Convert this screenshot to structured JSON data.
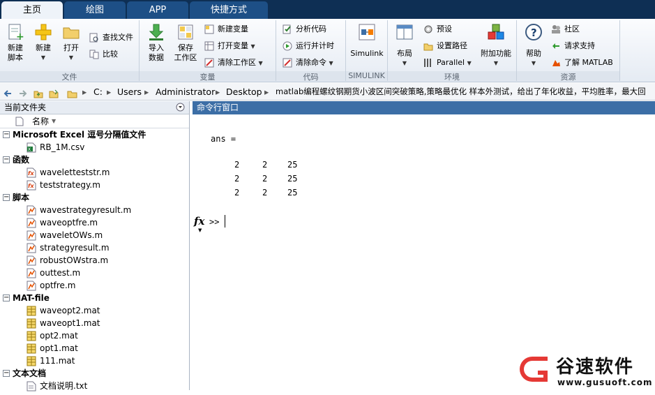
{
  "tabs": [
    {
      "label": "主页",
      "active": true
    },
    {
      "label": "绘图",
      "active": false
    },
    {
      "label": "APP",
      "active": false
    },
    {
      "label": "快捷方式",
      "active": false
    }
  ],
  "ribbon": {
    "file_group": {
      "label": "文件",
      "new_script": "新建\n脚本",
      "new": "新建",
      "open": "打开",
      "find_files": "查找文件",
      "compare": "比较"
    },
    "variable_group": {
      "label": "变量",
      "import_data": "导入\n数据",
      "save_workspace": "保存\n工作区",
      "new_variable": "新建变量",
      "open_variable": "打开变量",
      "clear_workspace": "清除工作区"
    },
    "code_group": {
      "label": "代码",
      "analyze_code": "分析代码",
      "run_and_time": "运行并计时",
      "clear_commands": "清除命令"
    },
    "simulink_group": {
      "label": "SIMULINK",
      "simulink": "Simulink"
    },
    "environment_group": {
      "label": "环境",
      "layout": "布局",
      "preferences": "预设",
      "set_path": "设置路径",
      "parallel": "Parallel",
      "add_ons": "附加功能"
    },
    "resources_group": {
      "label": "资源",
      "help": "帮助",
      "community": "社区",
      "request_support": "请求支持",
      "learn_matlab": "了解 MATLAB"
    }
  },
  "address": {
    "segments": [
      "C:",
      "Users",
      "Administrator",
      "Desktop",
      "matlab编程螺纹钢期货小波区间突破策略,策略最优化 样本外测试，给出了年化收益，平均胜率，最大回"
    ]
  },
  "current_folder": {
    "title": "当前文件夹",
    "column_name": "名称",
    "categories": [
      {
        "name": "Microsoft Excel 逗号分隔值文件",
        "files": [
          {
            "name": "RB_1M.csv",
            "icon": "csv-file-icon"
          }
        ]
      },
      {
        "name": "函数",
        "files": [
          {
            "name": "waveletteststr.m",
            "icon": "function-file-icon"
          },
          {
            "name": "teststrategy.m",
            "icon": "function-file-icon"
          }
        ]
      },
      {
        "name": "脚本",
        "files": [
          {
            "name": "wavestrategyresult.m",
            "icon": "script-file-icon"
          },
          {
            "name": "waveoptfre.m",
            "icon": "script-file-icon"
          },
          {
            "name": "waveletOWs.m",
            "icon": "script-file-icon"
          },
          {
            "name": "strategyresult.m",
            "icon": "script-file-icon"
          },
          {
            "name": "robustOWstra.m",
            "icon": "script-file-icon"
          },
          {
            "name": "outtest.m",
            "icon": "script-file-icon"
          },
          {
            "name": "optfre.m",
            "icon": "script-file-icon"
          }
        ]
      },
      {
        "name": "MAT-file",
        "files": [
          {
            "name": "waveopt2.mat",
            "icon": "mat-file-icon"
          },
          {
            "name": "waveopt1.mat",
            "icon": "mat-file-icon"
          },
          {
            "name": "opt2.mat",
            "icon": "mat-file-icon"
          },
          {
            "name": "opt1.mat",
            "icon": "mat-file-icon"
          },
          {
            "name": "111.mat",
            "icon": "mat-file-icon"
          }
        ]
      },
      {
        "name": "文本文档",
        "files": [
          {
            "name": "文档说明.txt",
            "icon": "text-file-icon"
          }
        ]
      }
    ]
  },
  "command_window": {
    "title": "命令行窗口",
    "output_label": "ans =",
    "rows": [
      [
        "2",
        "2",
        "25"
      ],
      [
        "2",
        "2",
        "25"
      ],
      [
        "2",
        "2",
        "25"
      ]
    ],
    "fx_label": "fx",
    "prompt": ">>"
  },
  "watermark": {
    "name": "谷速软件",
    "url": "www.gusuoft.com"
  }
}
